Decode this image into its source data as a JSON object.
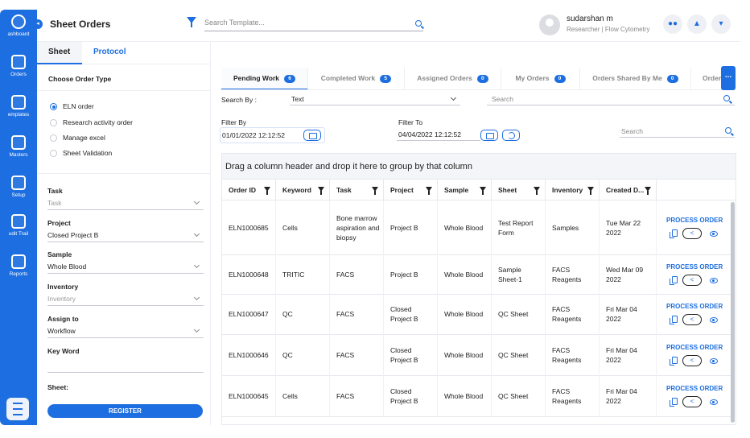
{
  "nav": {
    "items": [
      {
        "label": "ashboard",
        "icon": "dashboard-gauge-icon"
      },
      {
        "label": "Orders",
        "icon": "orders-book-icon"
      },
      {
        "label": "emplates",
        "icon": "templates-file-add-icon"
      },
      {
        "label": "Masters",
        "icon": "masters-hierarchy-icon"
      },
      {
        "label": "Setup",
        "icon": "setup-network-icon"
      },
      {
        "label": "udit Trail",
        "icon": "audit-trail-icon"
      },
      {
        "label": "Reports",
        "icon": "reports-document-icon"
      }
    ]
  },
  "header": {
    "title": "Sheet Orders",
    "search_placeholder": "Search Template...",
    "user_name": "sudarshan m",
    "user_role": "Researcher | Flow Cytometry"
  },
  "left": {
    "tabs": [
      "Sheet",
      "Protocol"
    ],
    "order_type_title": "Choose Order Type",
    "order_types": [
      "ELN order",
      "Research activity order",
      "Manage excel",
      "Sheet Validation"
    ],
    "selected_order_type": "ELN order",
    "fields": [
      {
        "label": "Task",
        "value": "Task",
        "placeholder": true
      },
      {
        "label": "Project",
        "value": "Closed Project B",
        "placeholder": false
      },
      {
        "label": "Sample",
        "value": "Whole Blood",
        "placeholder": false
      },
      {
        "label": "Inventory",
        "value": "Inventory",
        "placeholder": true
      },
      {
        "label": "Assign to",
        "value": "Workflow",
        "placeholder": false
      }
    ],
    "keyword_label": "Key Word",
    "sheet_label": "Sheet:",
    "register_label": "REGISTER"
  },
  "work_tabs": [
    {
      "label": "Pending Work",
      "count": "6"
    },
    {
      "label": "Completed Work",
      "count": "5"
    },
    {
      "label": "Assigned Orders",
      "count": "0"
    },
    {
      "label": "My Orders",
      "count": "0"
    },
    {
      "label": "Orders Shared By Me",
      "count": "0"
    },
    {
      "label": "Order",
      "count": ""
    }
  ],
  "more_label": "...",
  "filters": {
    "search_by_label": "Search By :",
    "search_by_value": "Text",
    "search_placeholder": "Search",
    "filter_by_label": "Filter By",
    "filter_by_value": "01/01/2022 12:12:52",
    "filter_to_label": "Filter To",
    "filter_to_value": "04/04/2022 12:12:52",
    "search2_placeholder": "Search"
  },
  "grid": {
    "group_hint": "Drag a column header and drop it here to group by that column",
    "columns": [
      "Order ID",
      "Keyword",
      "Task",
      "Project",
      "Sample",
      "Sheet",
      "Inventory",
      "Created D..."
    ],
    "action_label": "PROCESS ORDER",
    "rows": [
      {
        "order_id": "ELN1000685",
        "keyword": "Cells",
        "task": "Bone marrow aspiration and biopsy",
        "project": "Project B",
        "sample": "Whole Blood",
        "sheet": "Test Report Form",
        "inventory": "Samples",
        "created": "Tue Mar 22 2022"
      },
      {
        "order_id": "ELN1000648",
        "keyword": "TRITIC",
        "task": "FACS",
        "project": "Project B",
        "sample": "Whole Blood",
        "sheet": "Sample Sheet-1",
        "inventory": "FACS Reagents",
        "created": "Wed Mar 09 2022"
      },
      {
        "order_id": "ELN1000647",
        "keyword": "QC",
        "task": "FACS",
        "project": "Closed Project B",
        "sample": "Whole Blood",
        "sheet": "QC Sheet",
        "inventory": "FACS Reagents",
        "created": "Fri Mar 04 2022"
      },
      {
        "order_id": "ELN1000646",
        "keyword": "QC",
        "task": "FACS",
        "project": "Closed Project B",
        "sample": "Whole Blood",
        "sheet": "QC Sheet",
        "inventory": "FACS Reagents",
        "created": "Fri Mar 04 2022"
      },
      {
        "order_id": "ELN1000645",
        "keyword": "Cells",
        "task": "FACS",
        "project": "Closed Project B",
        "sample": "Whole Blood",
        "sheet": "QC Sheet",
        "inventory": "FACS Reagents",
        "created": "Fri Mar 04 2022"
      }
    ]
  },
  "colors": {
    "accent": "#1d6ee0",
    "rail": "#1d6ee0"
  }
}
